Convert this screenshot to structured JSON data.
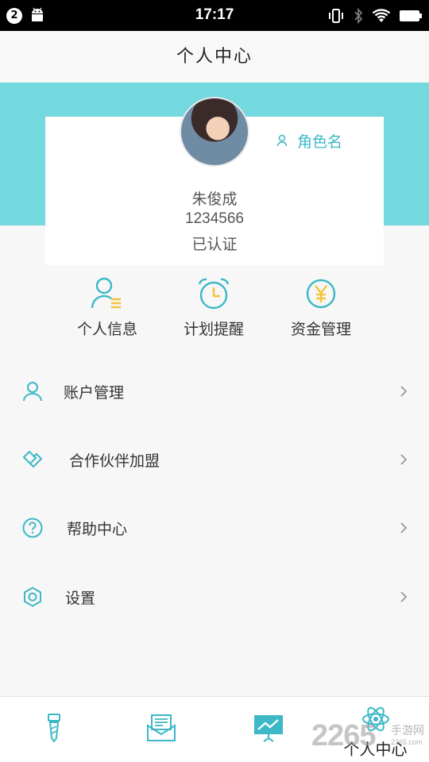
{
  "status_bar": {
    "notification_count": "2",
    "time": "17:17"
  },
  "nav": {
    "title": "个人中心"
  },
  "profile": {
    "role_label": "角色名",
    "name": "朱俊成",
    "id": "1234566",
    "status": "已认证"
  },
  "quick_actions": [
    {
      "label": "个人信息",
      "icon": "person-info-icon"
    },
    {
      "label": "计划提醒",
      "icon": "alarm-clock-icon"
    },
    {
      "label": "资金管理",
      "icon": "yen-coin-icon"
    }
  ],
  "menu": [
    {
      "label": "账户管理",
      "icon": "user-icon"
    },
    {
      "label": "合作伙伴加盟",
      "icon": "handshake-icon"
    },
    {
      "label": "帮助中心",
      "icon": "question-circle-icon"
    },
    {
      "label": "设置",
      "icon": "hexagon-settings-icon"
    }
  ],
  "tabs": [
    {
      "label": "",
      "icon": "tie-icon"
    },
    {
      "label": "",
      "icon": "envelope-icon"
    },
    {
      "label": "",
      "icon": "presentation-chart-icon"
    },
    {
      "label": "个人中心",
      "icon": "atom-icon"
    }
  ],
  "watermark": {
    "brand": "2265",
    "sub": "手游网",
    "url": "2265.com"
  },
  "colors": {
    "accent": "#74d8df",
    "icon_teal": "#3cb8c6",
    "icon_yellow": "#f2c53d"
  }
}
